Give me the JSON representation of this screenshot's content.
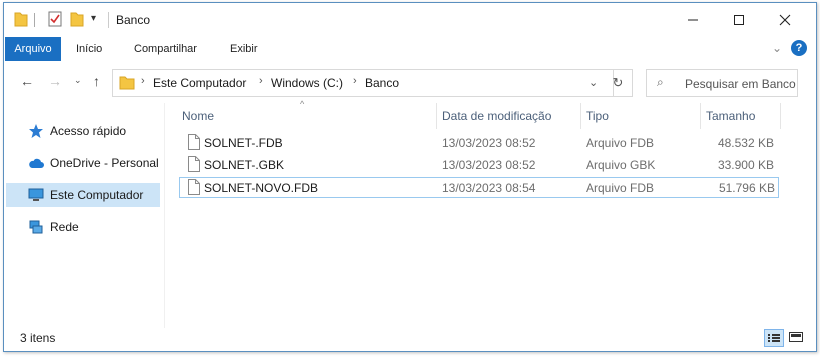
{
  "window": {
    "title": "Banco"
  },
  "ribbon": {
    "tabs": [
      "Arquivo",
      "Início",
      "Compartilhar",
      "Exibir"
    ]
  },
  "address": {
    "crumbs": [
      "Este Computador",
      "Windows (C:)",
      "Banco"
    ]
  },
  "search": {
    "placeholder": "Pesquisar em Banco"
  },
  "nav": {
    "items": [
      {
        "label": "Acesso rápido",
        "icon": "star-icon"
      },
      {
        "label": "OneDrive - Personal",
        "icon": "cloud-icon"
      },
      {
        "label": "Este Computador",
        "icon": "computer-icon",
        "selected": true
      },
      {
        "label": "Rede",
        "icon": "network-icon"
      }
    ]
  },
  "columns": [
    "Nome",
    "Data de modificação",
    "Tipo",
    "Tamanho"
  ],
  "files": [
    {
      "name": "SOLNET-.FDB",
      "date": "13/03/2023 08:52",
      "type": "Arquivo FDB",
      "size": "48.532 KB"
    },
    {
      "name": "SOLNET-.GBK",
      "date": "13/03/2023 08:52",
      "type": "Arquivo GBK",
      "size": "33.900 KB"
    },
    {
      "name": "SOLNET-NOVO.FDB",
      "date": "13/03/2023 08:54",
      "type": "Arquivo FDB",
      "size": "51.796 KB"
    }
  ],
  "status": {
    "count": "3 itens"
  },
  "colors": {
    "accent": "#1a6fc2",
    "selection": "#cce4f7",
    "focus_border": "#99c9ef"
  }
}
